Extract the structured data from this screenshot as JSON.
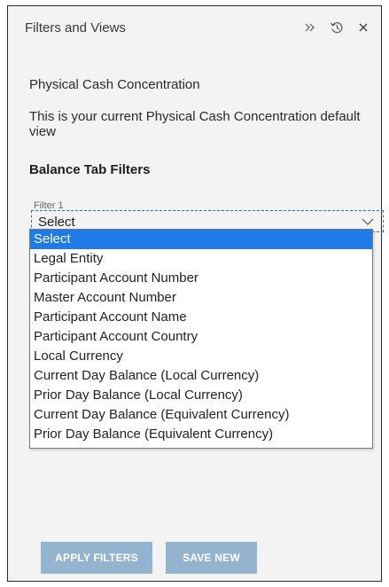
{
  "header": {
    "title": "Filters and Views",
    "icons": [
      "double-chevron-right-icon",
      "history-icon",
      "close-icon"
    ]
  },
  "view": {
    "name": "Physical Cash Concentration",
    "description": "This is your current Physical Cash Concentration default view"
  },
  "balance_filters": {
    "heading": "Balance Tab Filters",
    "filter1": {
      "label": "Filter 1",
      "value": "Select"
    }
  },
  "dropdown": {
    "options": [
      "Select",
      "Legal Entity",
      "Participant Account Number",
      "Master Account Number",
      "Participant Account Name",
      "Participant Account Country",
      "Local Currency",
      "Current Day Balance (Local Currency)",
      "Prior Day Balance (Local Currency)",
      "Current Day Balance (Equivalent Currency)",
      "Prior Day Balance (Equivalent Currency)"
    ],
    "selected": "Select"
  },
  "actions": {
    "apply_label": "APPLY FILTERS",
    "save_label": "SAVE NEW"
  },
  "colors": {
    "panel_bg": "#f3f3f3",
    "highlight": "#1e7be8",
    "button_bg": "#94b3cf",
    "focus_border": "#2d6fb3"
  }
}
